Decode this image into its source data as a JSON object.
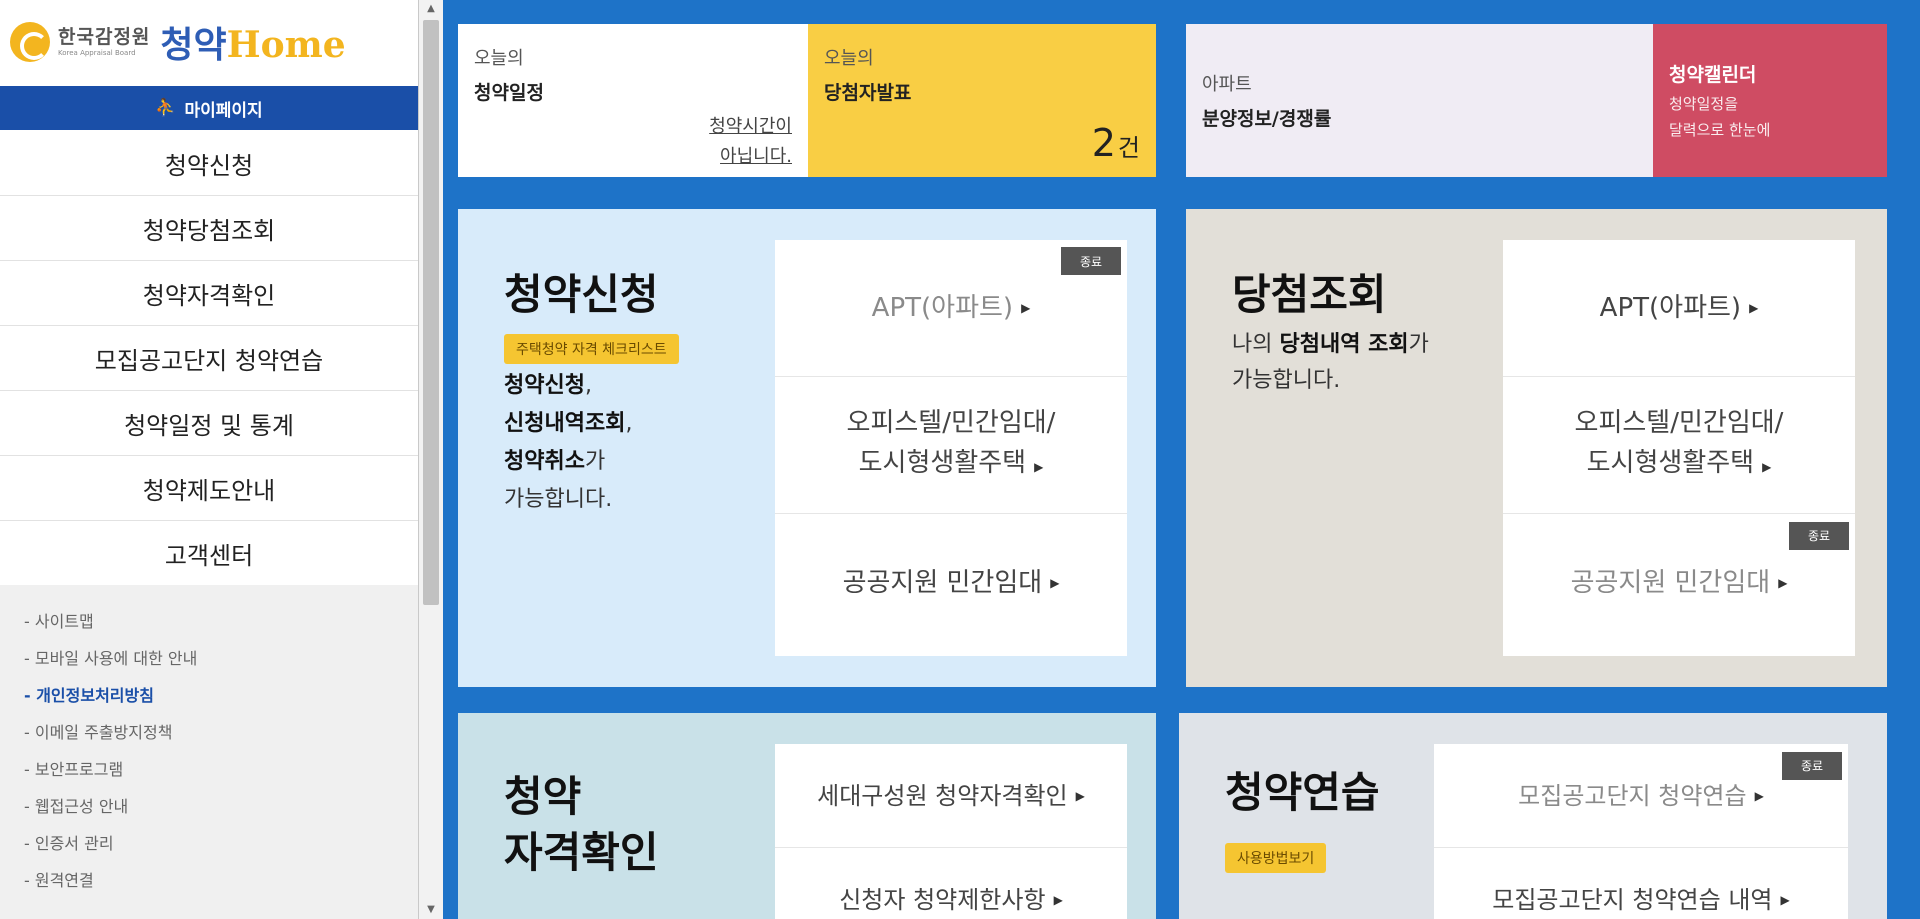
{
  "colors": {
    "background": "#1e73c8",
    "primary_blue": "#1a4fa8",
    "yellow": "#f9ce44",
    "pink": "#cf4c63",
    "apply_card": "#d8ebfa",
    "win_card": "#e2dfd8"
  },
  "logo": {
    "org": "한국감정원",
    "org_en": "Korea Appraisal Board",
    "brand_prefix": "청약",
    "brand_suffix": "Home",
    "icon": "kab-logo-icon"
  },
  "sidebar": {
    "mypage": "마이페이지",
    "mypage_icon": "person-icon",
    "nav": [
      {
        "label": "청약신청"
      },
      {
        "label": "청약당첨조회"
      },
      {
        "label": "청약자격확인"
      },
      {
        "label": "모집공고단지 청약연습"
      },
      {
        "label": "청약일정 및 통계"
      },
      {
        "label": "청약제도안내"
      },
      {
        "label": "고객센터"
      }
    ],
    "footer_links": [
      {
        "label": "- 사이트맵"
      },
      {
        "label": "- 모바일 사용에 대한 안내"
      },
      {
        "label": "- 개인정보처리방침"
      },
      {
        "label": "- 이메일 주출방지정책"
      },
      {
        "label": "- 보안프로그램"
      },
      {
        "label": "- 웹접근성 안내"
      },
      {
        "label": "- 인증서 관리"
      },
      {
        "label": "- 원격연결"
      }
    ]
  },
  "top": {
    "today_schedule": {
      "small": "오늘의",
      "big": "청약일정",
      "note_line1": "청약시간이",
      "note_line2": "아닙니다."
    },
    "today_winners": {
      "small": "오늘의",
      "big": "당첨자발표",
      "count": "2",
      "unit": "건"
    },
    "apt_info": {
      "small": "아파트",
      "big": "분양정보/경쟁률"
    },
    "calendar": {
      "title": "청약캘린더",
      "sub_line1": "청약일정을",
      "sub_line2": "달력으로 한눈에"
    }
  },
  "card_apply": {
    "title": "청약신청",
    "badge": "주택청약 자격 체크리스트",
    "desc": {
      "l1_bold": "청약신청",
      "l1_rest": ",",
      "l2_bold": "신청내역조회",
      "l2_rest": ",",
      "l3_bold": "청약취소",
      "l3_rest": "가",
      "l4": "가능합니다."
    },
    "end_tag": "종료",
    "menu": [
      {
        "label": "APT(아파트)"
      },
      {
        "label_l1": "오피스텔/민간임대/",
        "label_l2": "도시형생활주택"
      },
      {
        "label": "공공지원 민간임대"
      }
    ]
  },
  "card_win": {
    "title": "당첨조회",
    "desc": {
      "pre": "나의 ",
      "bold": "당첨내역 조회",
      "rest": "가",
      "l2": "가능합니다."
    },
    "end_tag": "종료",
    "menu": [
      {
        "label": "APT(아파트)"
      },
      {
        "label_l1": "오피스텔/민간임대/",
        "label_l2": "도시형생활주택"
      },
      {
        "label": "공공지원 민간임대"
      }
    ]
  },
  "card_qual": {
    "title_l1": "청약",
    "title_l2": "자격확인",
    "menu": [
      {
        "label": "세대구성원 청약자격확인"
      },
      {
        "label": "신청자 청약제한사항"
      }
    ]
  },
  "card_practice": {
    "title": "청약연습",
    "badge": "사용방법보기",
    "end_tag": "종료",
    "menu": [
      {
        "label": "모집공고단지 청약연습"
      },
      {
        "label": "모집공고단지 청약연습 내역"
      }
    ]
  },
  "scroll": {
    "up": "▲",
    "down": "▼"
  }
}
